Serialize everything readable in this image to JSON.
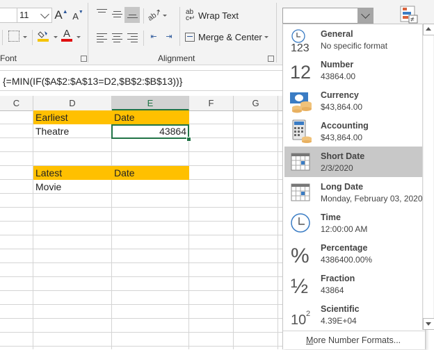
{
  "ribbon": {
    "font_size_value": "11",
    "font_group_label": "Font",
    "alignment_group_label": "Alignment",
    "wrap_text_label": "Wrap Text",
    "merge_center_label": "Merge & Center",
    "fill_color": "#f4c300",
    "font_color": "#e01010"
  },
  "formula_bar": {
    "formula": "{=MIN(IF($A$2:$A$13=D2,$B$2:$B$13))}"
  },
  "grid": {
    "columns": [
      "C",
      "D",
      "E",
      "F",
      "G"
    ],
    "selected_column": "E",
    "cells": {
      "D1": "Earliest",
      "E1": "Date",
      "D2": "Theatre",
      "E2": "43864",
      "D5": "Latest",
      "E5": "Date",
      "D6": "Movie"
    },
    "header_fill": "#ffc000",
    "selection_color": "#217346"
  },
  "number_format": {
    "current_value": "",
    "options": [
      {
        "name": "General",
        "preview": "No specific format",
        "icon": "general-clock-123-icon"
      },
      {
        "name": "Number",
        "preview": "43864.00",
        "icon": "number-12-icon"
      },
      {
        "name": "Currency",
        "preview": "$43,864.00",
        "icon": "currency-bill-coins-icon"
      },
      {
        "name": "Accounting",
        "preview": " $43,864.00",
        "icon": "accounting-calculator-icon"
      },
      {
        "name": "Short Date",
        "preview": "2/3/2020",
        "icon": "calendar-icon",
        "highlighted": true
      },
      {
        "name": "Long Date",
        "preview": "Monday, February 03, 2020",
        "icon": "calendar-icon"
      },
      {
        "name": "Time",
        "preview": "12:00:00 AM",
        "icon": "clock-icon"
      },
      {
        "name": "Percentage",
        "preview": "4386400.00%",
        "icon": "percent-icon"
      },
      {
        "name": "Fraction",
        "preview": "43864",
        "icon": "fraction-icon"
      },
      {
        "name": "Scientific",
        "preview": "4.39E+04",
        "icon": "scientific-icon"
      }
    ],
    "more_label_first": "M",
    "more_label_rest": "ore Number Formats..."
  }
}
